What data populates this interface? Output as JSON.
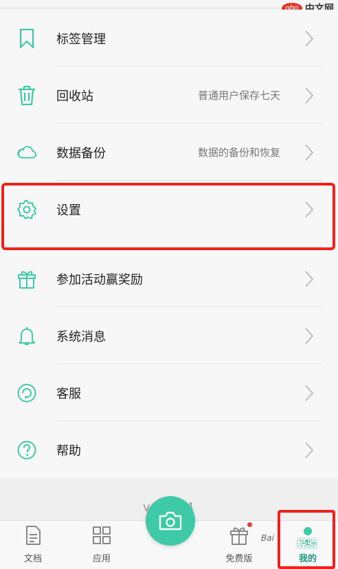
{
  "watermark": {
    "badge": "php",
    "text": "中文网"
  },
  "menu": {
    "group1": [
      {
        "label": "标签管理",
        "hint": "",
        "icon": "bookmark-icon"
      },
      {
        "label": "回收站",
        "hint": "普通用户保存七天",
        "icon": "trash-icon"
      },
      {
        "label": "数据备份",
        "hint": "数据的备份和恢复",
        "icon": "cloud-icon"
      },
      {
        "label": "设置",
        "hint": "",
        "icon": "gear-icon"
      }
    ],
    "group2": [
      {
        "label": "参加活动赢奖励",
        "hint": "",
        "icon": "gift-icon"
      },
      {
        "label": "系统消息",
        "hint": "",
        "icon": "bell-icon"
      },
      {
        "label": "客服",
        "hint": "",
        "icon": "headset-icon"
      },
      {
        "label": "帮助",
        "hint": "",
        "icon": "help-icon"
      }
    ]
  },
  "version": "v 6.2.4",
  "tabbar": {
    "tabs": [
      {
        "label": "文档",
        "icon": "document-icon"
      },
      {
        "label": "应用",
        "icon": "apps-grid-icon"
      },
      {
        "label": "免费版",
        "icon": "gift-icon"
      },
      {
        "label": "我的",
        "icon": "person-icon"
      }
    ],
    "overlay_text": "经验",
    "baidu_text": "Bai"
  },
  "colors": {
    "accent": "#3ec9a7",
    "highlight": "#f0201a"
  }
}
